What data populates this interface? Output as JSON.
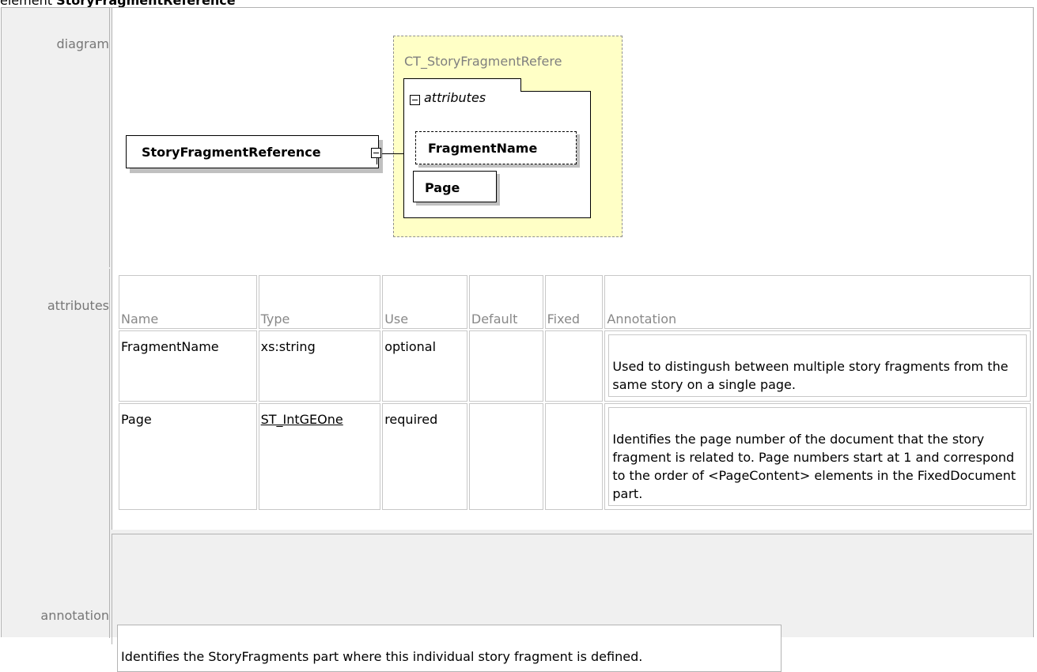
{
  "heading": {
    "prefix": "element ",
    "name": "StoryFragmentReference"
  },
  "rows": {
    "diagram_label": "diagram",
    "attributes_label": "attributes",
    "annotation_label": "annotation"
  },
  "diagram": {
    "element_name": "StoryFragmentReference",
    "complex_type": "CT_StoryFragmentRefere",
    "attributes_group": "attributes",
    "attr_fragment": "FragmentName",
    "attr_page": "Page"
  },
  "attributes_table": {
    "headers": [
      "Name",
      "Type",
      "Use",
      "Default",
      "Fixed",
      "Annotation"
    ],
    "rows": [
      {
        "name": "FragmentName",
        "type": "xs:string",
        "use": "optional",
        "default": "",
        "fixed": "",
        "annotation": "Used to distingush between multiple story fragments from the same story on a single page."
      },
      {
        "name": "Page",
        "type": "ST_IntGEOne",
        "use": "required",
        "default": "",
        "fixed": "",
        "annotation": "Identifies the page number of the document that the story fragment is related to. Page numbers start at 1 and correspond to the order of <PageContent> elements in the FixedDocument part."
      }
    ]
  },
  "annotation": {
    "text": "Identifies the StoryFragments part where this individual story fragment is defined."
  }
}
